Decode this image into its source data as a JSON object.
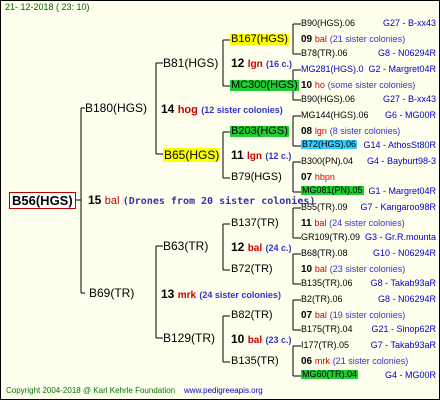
{
  "date": "21- 12-2018 ( 23: 10)",
  "root": {
    "label": "B56(HGS)",
    "year": "15",
    "sister": "bal",
    "drones": "(Drones from 20 sister colonies)"
  },
  "gen1": [
    {
      "label": "B180(HGS)",
      "year": "14",
      "sister": "hog",
      "colonies": "(12 sister colonies)"
    },
    {
      "label": "B69(TR)",
      "year": "13",
      "sister": "mrk",
      "colonies": "(24 sister colonies)"
    }
  ],
  "gen2": [
    {
      "label": "B81(HGS)",
      "year": "12",
      "sister": "lgn",
      "colonies": "(16 c.)"
    },
    {
      "label": "B65(HGS)",
      "year": "11",
      "sister": "lgn",
      "colonies": "(12 c.)"
    },
    {
      "label": "B63(TR)",
      "year": "12",
      "sister": "bal",
      "colonies": "(24 c.)"
    },
    {
      "label": "B129(TR)",
      "year": "10",
      "sister": "bal",
      "colonies": "(23 c.)"
    }
  ],
  "gen3": [
    {
      "label": "B167(HGS)",
      "year": "09",
      "sister": "bal",
      "colonies": "(21 sister colonies)"
    },
    {
      "label": "MC300(HGS)",
      "year": "10",
      "sister": "ho",
      "colonies": "(some sister colonies)"
    },
    {
      "label": "B203(HGS)",
      "year": "08",
      "sister": "lgn",
      "colonies": "(8 sister colonies)"
    },
    {
      "label": "B79(HGS)",
      "year": "07",
      "sister": "hbpn",
      "colonies": ""
    },
    {
      "label": "B137(TR)",
      "year": "11",
      "sister": "bal",
      "colonies": "(24 sister colonies)"
    },
    {
      "label": "B72(TR)",
      "year": "10",
      "sister": "bal",
      "colonies": "(23 sister colonies)"
    },
    {
      "label": "B82(TR)",
      "year": "07",
      "sister": "bal",
      "colonies": "(19 sister colonies)"
    },
    {
      "label": "B135(TR)",
      "year": "06",
      "sister": "mrk",
      "colonies": "(21 sister colonies)"
    }
  ],
  "gen4": [
    {
      "label": "B90(HGS).06",
      "ref": "G27 - B-xx43"
    },
    {
      "label": "B78(TR).06",
      "ref": "G8 - N06294R"
    },
    {
      "label": "MG281(HGS).0",
      "ref": "G2 - Margret04R"
    },
    {
      "label": "B90(HGS).06",
      "ref": "G27 - B-xx43"
    },
    {
      "label": "MG144(HGS).06",
      "ref": "G6 - MG00R"
    },
    {
      "label": "B72(HGS).06",
      "ref": "G14 - AthosSt80R"
    },
    {
      "label": "B300(PN).04",
      "ref": "G4 - Bayburt98-3"
    },
    {
      "label": "MG081(PN).05",
      "ref": "G1 - Margret04R"
    },
    {
      "label": "B55(TR).09",
      "ref": "G7 - Kangaroo98R"
    },
    {
      "label": "GR109(TR).09",
      "ref": "G3 - Gr.R.mounta"
    },
    {
      "label": "B68(TR).08",
      "ref": "G10 - N06294R"
    },
    {
      "label": "B135(TR).06",
      "ref": "G8 - Takab93aR"
    },
    {
      "label": "B2(TR).06",
      "ref": "G8 - N06294R"
    },
    {
      "label": "B175(TR).04",
      "ref": "G21 - Sinop62R"
    },
    {
      "label": "I177(TR).05",
      "ref": "G7 - Takab93aR"
    },
    {
      "label": "MG60(TR).04",
      "ref": "G4 - MG00R"
    }
  ],
  "footer": {
    "copyright": "Copyright 2004-2018 @ Karl Kehrle Foundation",
    "url": "www.pedigreeapis.org"
  }
}
